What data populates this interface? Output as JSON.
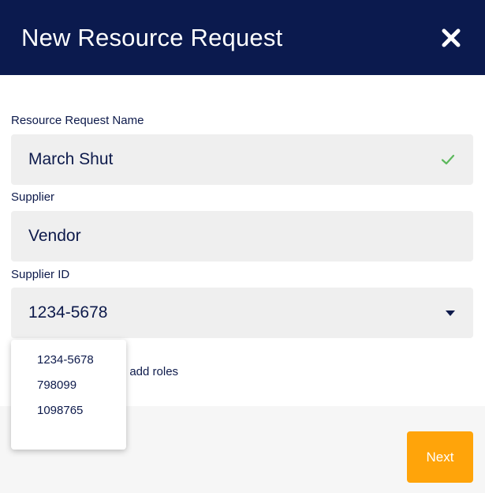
{
  "modal": {
    "title": "New Resource Request",
    "close_icon": "close-icon"
  },
  "form": {
    "resource_request_name": {
      "label": "Resource Request Name",
      "value": "March Shut",
      "status_icon": "check-icon",
      "status_color": "#5cb85c"
    },
    "supplier": {
      "label": "Supplier",
      "value": "Vendor"
    },
    "supplier_id": {
      "label": "Supplier ID",
      "value": "1234-5678",
      "options": [
        "1234-5678",
        "798099",
        "1098765"
      ],
      "expanded": true
    },
    "hint_partial": "rs to add roles"
  },
  "footer": {
    "next_label": "Next",
    "next_color": "#ffa40a"
  },
  "colors": {
    "header_bg": "#0b1a4e",
    "field_bg": "#efefef",
    "text": "#0d1a4b"
  }
}
